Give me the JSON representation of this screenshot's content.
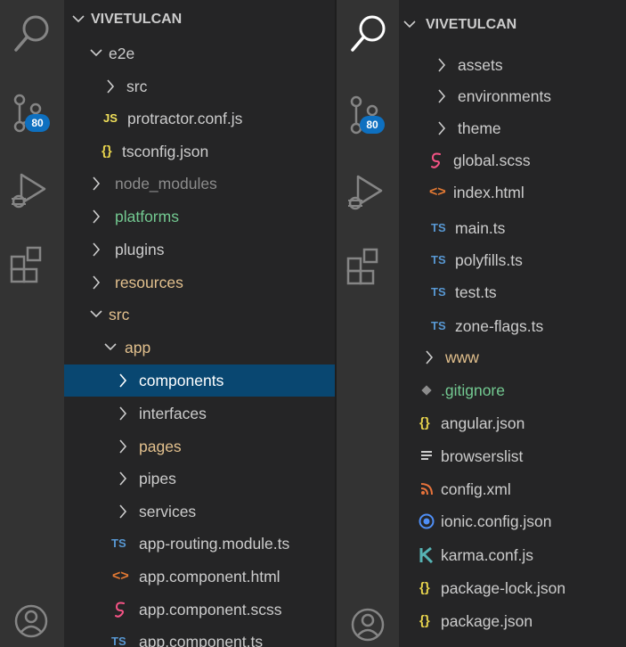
{
  "left_panel": {
    "activity_bar": {
      "source_control_badge": "80"
    },
    "explorer": {
      "root": "VIVETULCAN",
      "items": [
        {
          "label": "e2e"
        },
        {
          "label": "src"
        },
        {
          "label": "protractor.conf.js"
        },
        {
          "label": "tsconfig.json"
        },
        {
          "label": "node_modules"
        },
        {
          "label": "platforms"
        },
        {
          "label": "plugins"
        },
        {
          "label": "resources"
        },
        {
          "label": "src"
        },
        {
          "label": "app"
        },
        {
          "label": "components"
        },
        {
          "label": "interfaces"
        },
        {
          "label": "pages"
        },
        {
          "label": "pipes"
        },
        {
          "label": "services"
        },
        {
          "label": "app-routing.module.ts"
        },
        {
          "label": "app.component.html"
        },
        {
          "label": "app.component.scss"
        },
        {
          "label": "app.component.ts"
        }
      ]
    }
  },
  "right_panel": {
    "activity_bar": {
      "source_control_badge": "80"
    },
    "explorer": {
      "root": "VIVETULCAN",
      "items": [
        {
          "label": "assets"
        },
        {
          "label": "environments"
        },
        {
          "label": "theme"
        },
        {
          "label": "global.scss"
        },
        {
          "label": "index.html"
        },
        {
          "label": "main.ts"
        },
        {
          "label": "polyfills.ts"
        },
        {
          "label": "test.ts"
        },
        {
          "label": "zone-flags.ts"
        },
        {
          "label": "www"
        },
        {
          "label": ".gitignore"
        },
        {
          "label": "angular.json"
        },
        {
          "label": "browserslist"
        },
        {
          "label": "config.xml"
        },
        {
          "label": "ionic.config.json"
        },
        {
          "label": "karma.conf.js"
        },
        {
          "label": "package-lock.json"
        },
        {
          "label": "package.json"
        }
      ]
    }
  },
  "icon_glyphs": {
    "js": "JS",
    "ts": "TS",
    "json": "{}",
    "html": "<>"
  },
  "colors": {
    "background": "#252526",
    "activity_bar": "#333333",
    "selected_row": "#094771",
    "badge": "#0e70c0",
    "untracked_green": "#73c991",
    "modified_orange": "#e2c08d"
  }
}
